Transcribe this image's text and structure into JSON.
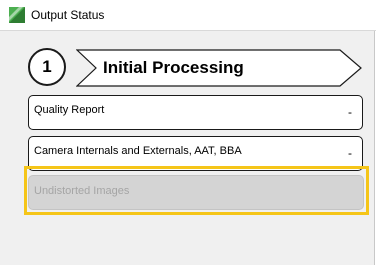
{
  "window": {
    "title": "Output Status",
    "icon": "app-logo-icon"
  },
  "step": {
    "number": "1",
    "title": "Initial Processing"
  },
  "items": [
    {
      "label": "Quality Report",
      "toggle": "-",
      "enabled": true
    },
    {
      "label": "Camera Internals and Externals, AAT, BBA",
      "toggle": "-",
      "enabled": true
    },
    {
      "label": "Undistorted Images",
      "enabled": false,
      "highlighted": true
    }
  ],
  "colors": {
    "highlight": "#f5c518",
    "disabled_background": "#d4d4d4",
    "disabled_text": "#a5a5a5"
  }
}
